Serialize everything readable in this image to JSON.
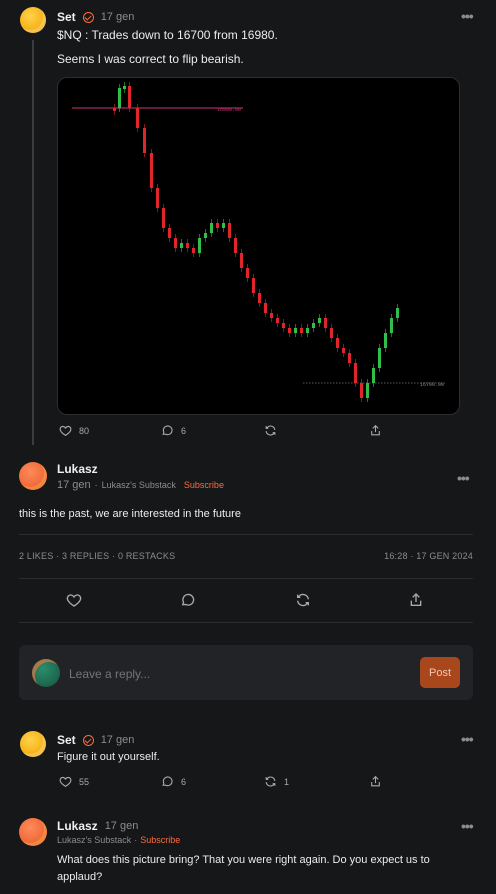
{
  "post": {
    "author": "Set",
    "date": "17 gen",
    "text1": "$NQ : Trades down to 16700 from 16980.",
    "text2": "Seems I was correct to flip bearish.",
    "likes": "80",
    "comments": "6",
    "chart_labels": {
      "top": "16980.00",
      "bottom": "16700.00"
    }
  },
  "reply": {
    "author": "Lukasz",
    "date": "17 gen",
    "separator": "·",
    "publication": "Lukasz's Substack",
    "subscribe": "Subscribe",
    "text": "this is the past, we are interested in the future",
    "stats": "2 LIKES · 3 REPLIES · 0 RESTACKS",
    "timestamp": "16:28 · 17 GEN 2024"
  },
  "composer": {
    "placeholder": "Leave a reply...",
    "post_label": "Post"
  },
  "replies": [
    {
      "author": "Set",
      "date": "17 gen",
      "text": "Figure it out yourself.",
      "likes": "55",
      "comments": "6",
      "restacks": "1"
    },
    {
      "author": "Lukasz",
      "date": "17 gen",
      "publication": "Lukasz's Substack",
      "separator": "·",
      "subscribe": "Subscribe",
      "text": "What does this picture bring? That you were right again. Do you expect us to applaud?"
    }
  ],
  "colors": {
    "accent": "#ff6a3d",
    "candle_up": "#2fbf4a",
    "candle_down": "#e0262b"
  },
  "icons": [
    "more-icon",
    "verified-check-icon",
    "heart-icon",
    "comment-icon",
    "restack-icon",
    "share-icon"
  ]
}
